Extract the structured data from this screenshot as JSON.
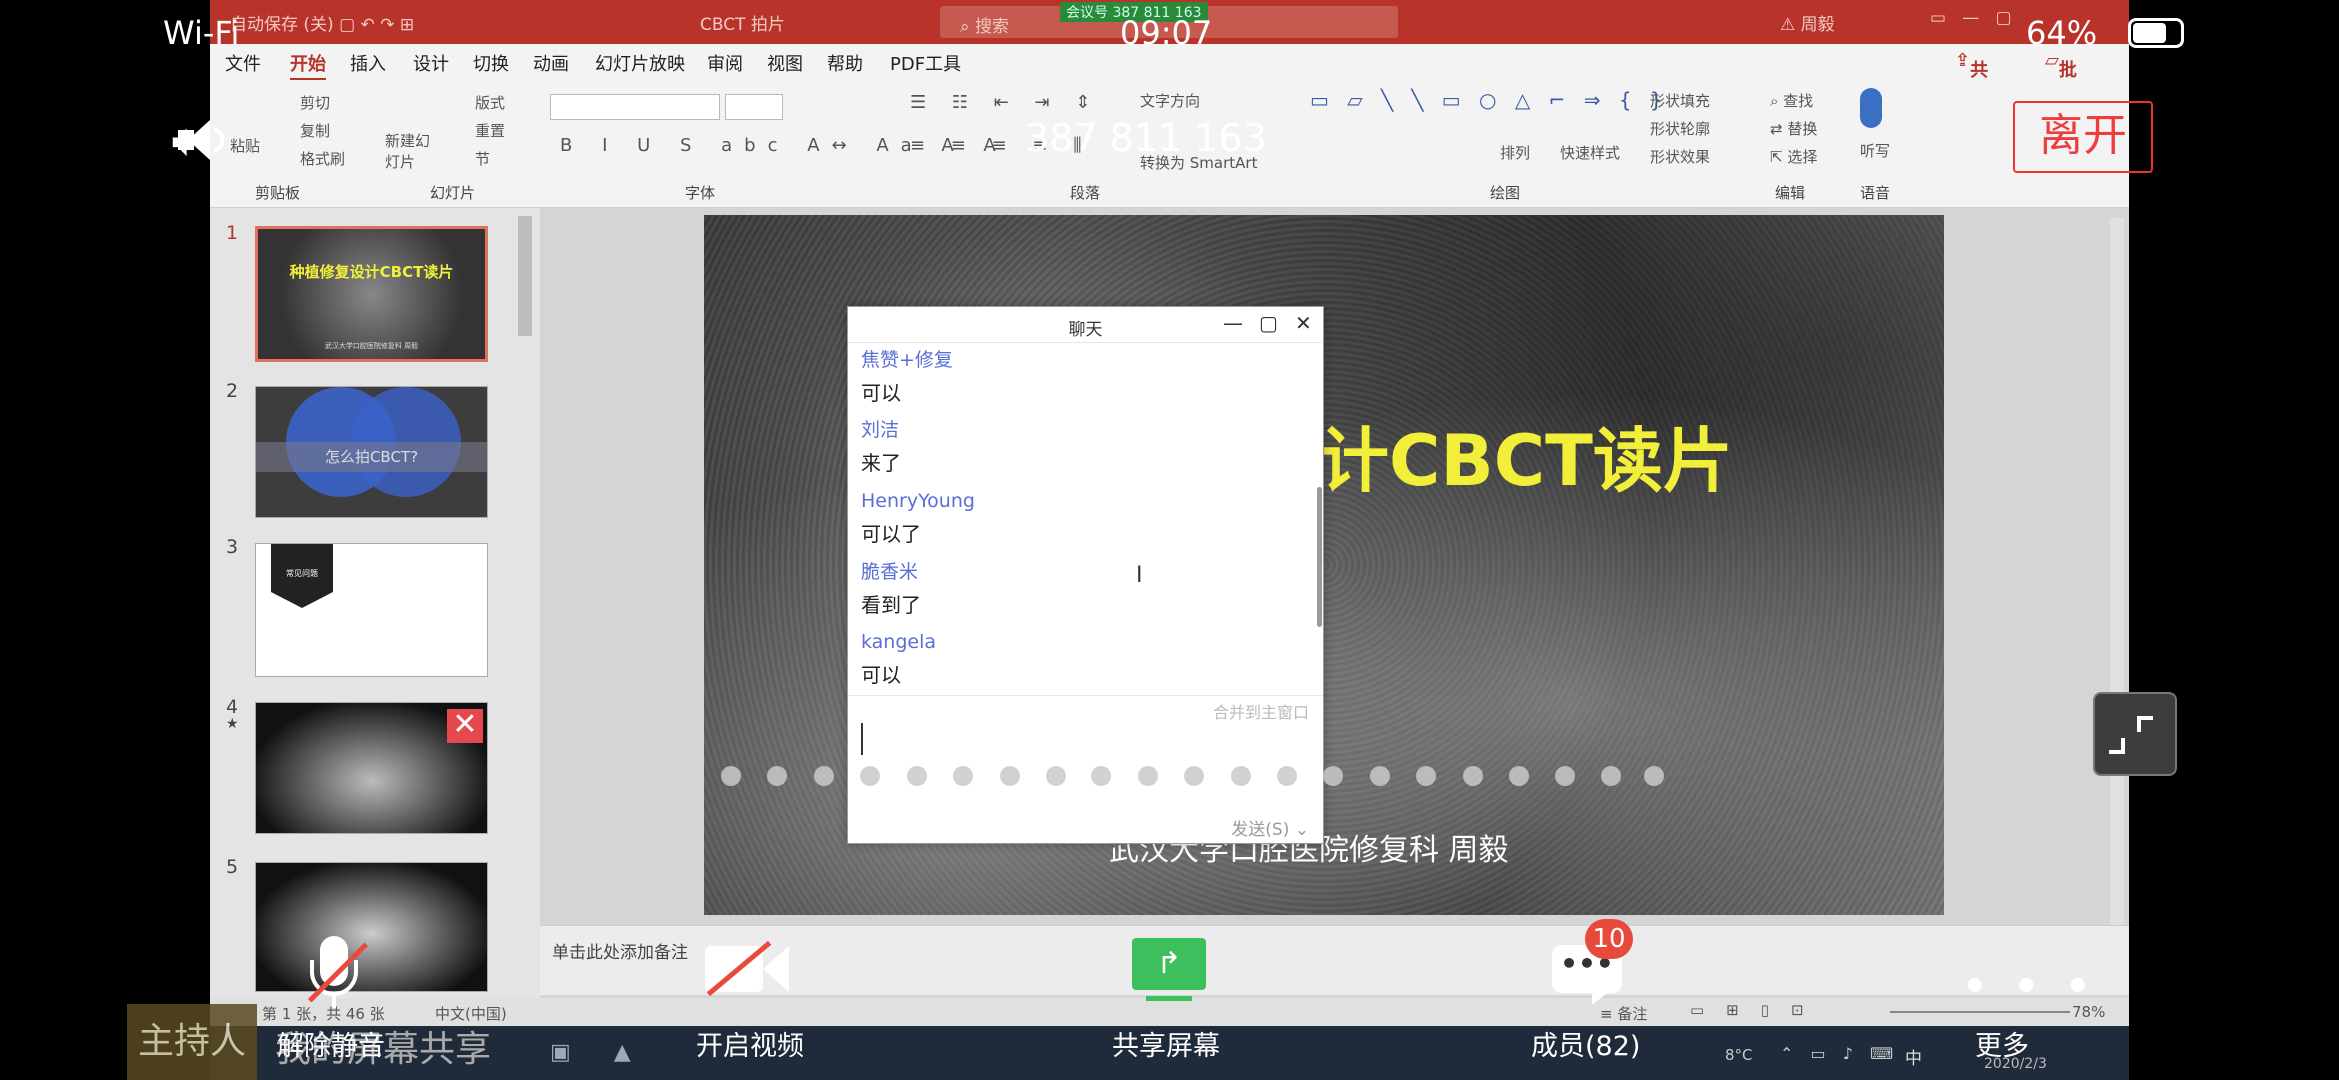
{
  "status_bar": {
    "wifi": "Wi-Fi",
    "time": "09:07",
    "battery": "64%"
  },
  "meeting": {
    "id": "387 811 163",
    "leave_label": "离开"
  },
  "ppt": {
    "window_title": "CBCT 拍片",
    "autosave": "自动保存",
    "autosave_state": "关",
    "search_placeholder": "搜索",
    "meeting_tip": "会议号 387 811 163",
    "user": "周毅",
    "menu": [
      "文件",
      "开始",
      "插入",
      "设计",
      "切换",
      "动画",
      "幻灯片放映",
      "审阅",
      "视图",
      "帮助",
      "PDF工具"
    ],
    "share": "共享",
    "comments": "批注",
    "ribbon": {
      "paste": "粘贴",
      "cut": "剪切",
      "copy": "复制",
      "format_painter": "格式刷",
      "new_slide": "新建幻灯片",
      "layout": "版式",
      "reset": "重置",
      "section": "节",
      "text_direction": "文字方向",
      "convert_smartart": "转换为 SmartArt",
      "arrange": "排列",
      "quick_styles": "快速样式",
      "shape_fill": "形状填充",
      "shape_outline": "形状轮廓",
      "shape_effects": "形状效果",
      "find": "查找",
      "replace": "替换",
      "select": "选择",
      "dictate": "听写",
      "groups": [
        "剪贴板",
        "幻灯片",
        "字体",
        "段落",
        "绘图",
        "编辑",
        "语音"
      ]
    },
    "thumbs": [
      {
        "num": "1",
        "title": "种植修复设计CBCT读片",
        "sub": "武汉大学口腔医院修复科 周毅"
      },
      {
        "num": "2",
        "title": "怎么拍CBCT?"
      },
      {
        "num": "3",
        "title": "常见问题"
      },
      {
        "num": "4",
        "star": "★"
      },
      {
        "num": "5"
      }
    ],
    "slide_title": "修复设计CBCT读片",
    "slide_sub": "武汉大学口腔医院修复科 周毅",
    "notes_placeholder": "单击此处添加备注",
    "status_left": "第 1 张，共 46 张",
    "status_lang": "中文(中国)",
    "status_notes": "备注",
    "zoom": "78%",
    "task_temp": "8°C",
    "task_ime": "中",
    "task_date": "2020/2/3"
  },
  "chat": {
    "title": "聊天",
    "messages": [
      {
        "sender": "焦赞+修复",
        "text": "可以"
      },
      {
        "sender": "刘洁",
        "text": "来了"
      },
      {
        "sender": "HenryYoung",
        "text": "可以了"
      },
      {
        "sender": "脆香米",
        "text": "看到了"
      },
      {
        "sender": "kangela",
        "text": "可以"
      }
    ],
    "merge_label": "合并到主窗口",
    "send_label": "发送(S)"
  },
  "bottom_bar": {
    "host_label": "主持人",
    "sharing_label": "我的屏幕共享",
    "unmute": "解除静音",
    "video": "开启视频",
    "share_screen": "共享屏幕",
    "members": "成员(82)",
    "members_badge": "10",
    "more": "更多"
  }
}
